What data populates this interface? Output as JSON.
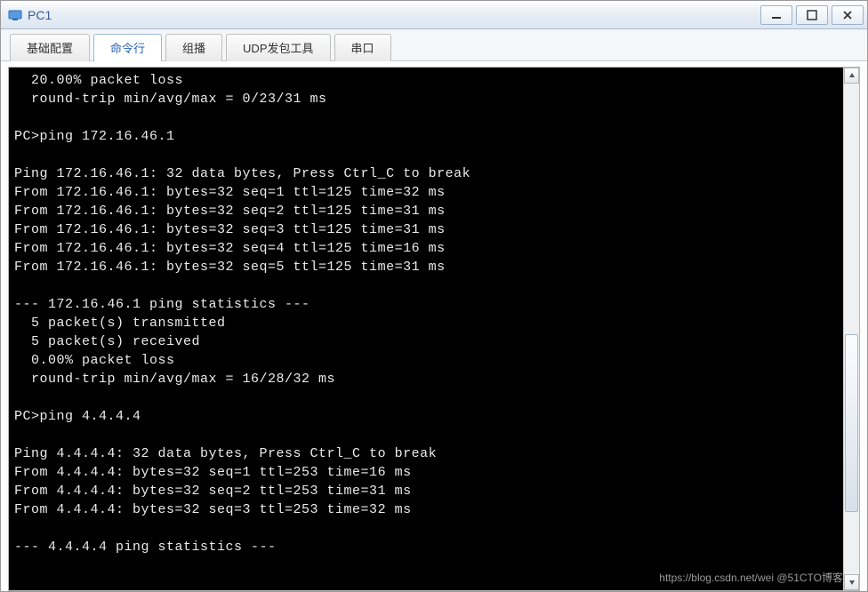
{
  "window": {
    "title": "PC1"
  },
  "tabs": [
    {
      "label": "基础配置",
      "active": false
    },
    {
      "label": "命令行",
      "active": true
    },
    {
      "label": "组播",
      "active": false
    },
    {
      "label": "UDP发包工具",
      "active": false
    },
    {
      "label": "串口",
      "active": false
    }
  ],
  "terminal": {
    "lines": [
      "  20.00% packet loss",
      "  round-trip min/avg/max = 0/23/31 ms",
      "",
      "PC>ping 172.16.46.1",
      "",
      "Ping 172.16.46.1: 32 data bytes, Press Ctrl_C to break",
      "From 172.16.46.1: bytes=32 seq=1 ttl=125 time=32 ms",
      "From 172.16.46.1: bytes=32 seq=2 ttl=125 time=31 ms",
      "From 172.16.46.1: bytes=32 seq=3 ttl=125 time=31 ms",
      "From 172.16.46.1: bytes=32 seq=4 ttl=125 time=16 ms",
      "From 172.16.46.1: bytes=32 seq=5 ttl=125 time=31 ms",
      "",
      "--- 172.16.46.1 ping statistics ---",
      "  5 packet(s) transmitted",
      "  5 packet(s) received",
      "  0.00% packet loss",
      "  round-trip min/avg/max = 16/28/32 ms",
      "",
      "PC>ping 4.4.4.4",
      "",
      "Ping 4.4.4.4: 32 data bytes, Press Ctrl_C to break",
      "From 4.4.4.4: bytes=32 seq=1 ttl=253 time=16 ms",
      "From 4.4.4.4: bytes=32 seq=2 ttl=253 time=31 ms",
      "From 4.4.4.4: bytes=32 seq=3 ttl=253 time=32 ms",
      "",
      "--- 4.4.4.4 ping statistics ---"
    ]
  },
  "watermark": "https://blog.csdn.net/wei @51CTO博客"
}
